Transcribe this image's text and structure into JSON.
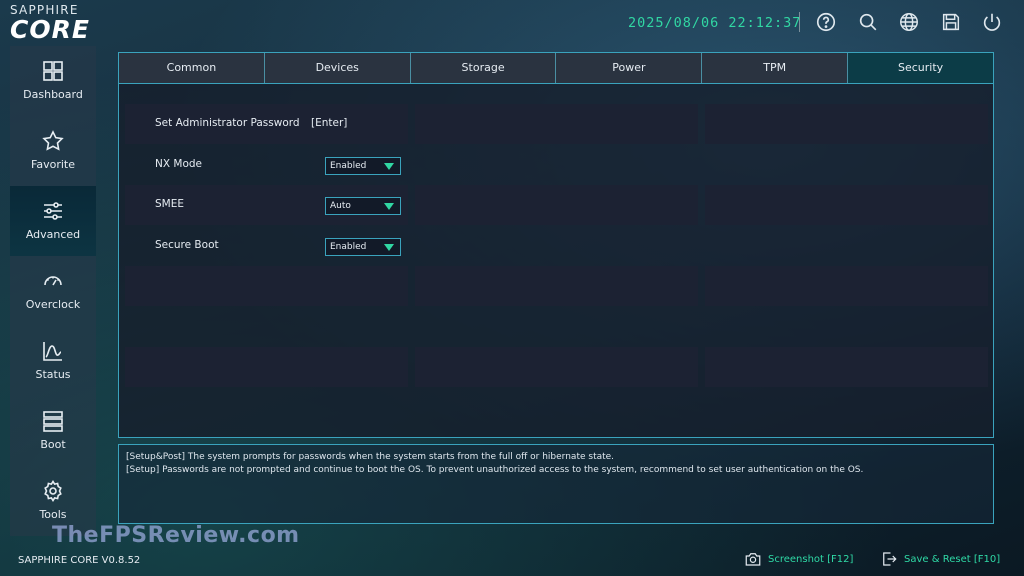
{
  "header": {
    "logo_small": "SAPPHIRE",
    "logo_big": "CORE",
    "datetime": "2025/08/06 22:12:37",
    "icons": [
      "help-icon",
      "search-icon",
      "globe-icon",
      "save-icon",
      "power-icon"
    ]
  },
  "sidebar": {
    "items": [
      {
        "label": "Dashboard",
        "icon": "dashboard-icon"
      },
      {
        "label": "Favorite",
        "icon": "star-icon"
      },
      {
        "label": "Advanced",
        "icon": "sliders-icon",
        "active": true
      },
      {
        "label": "Overclock",
        "icon": "gauge-icon"
      },
      {
        "label": "Status",
        "icon": "chart-icon"
      },
      {
        "label": "Boot",
        "icon": "boot-icon"
      },
      {
        "label": "Tools",
        "icon": "gear-icon"
      }
    ]
  },
  "tabs": [
    "Common",
    "Devices",
    "Storage",
    "Power",
    "TPM",
    "Security"
  ],
  "active_tab": "Security",
  "settings": [
    {
      "label": "Set Administrator Password",
      "value": "[Enter]",
      "type": "action"
    },
    {
      "label": "NX Mode",
      "value": "Enabled",
      "type": "dropdown"
    },
    {
      "label": "SMEE",
      "value": "Auto",
      "type": "dropdown"
    },
    {
      "label": "Secure Boot",
      "value": "Enabled",
      "type": "dropdown"
    }
  ],
  "help": {
    "line1": "[Setup&Post] The system prompts for passwords when the system starts from the full off or hibernate state.",
    "line2": "[Setup] Passwords are not prompted and continue to boot the OS. To prevent unauthorized access to the system, recommend to set user authentication on the OS."
  },
  "watermark": "TheFPSReview.com",
  "footer": {
    "version": "SAPPHIRE CORE V0.8.52",
    "screenshot_label": "Screenshot [F12]",
    "save_reset_label": "Save & Reset [F10]"
  },
  "colors": {
    "accent": "#31d7a3",
    "border": "#3aa3bd",
    "active_tab": "#0c3c47"
  }
}
